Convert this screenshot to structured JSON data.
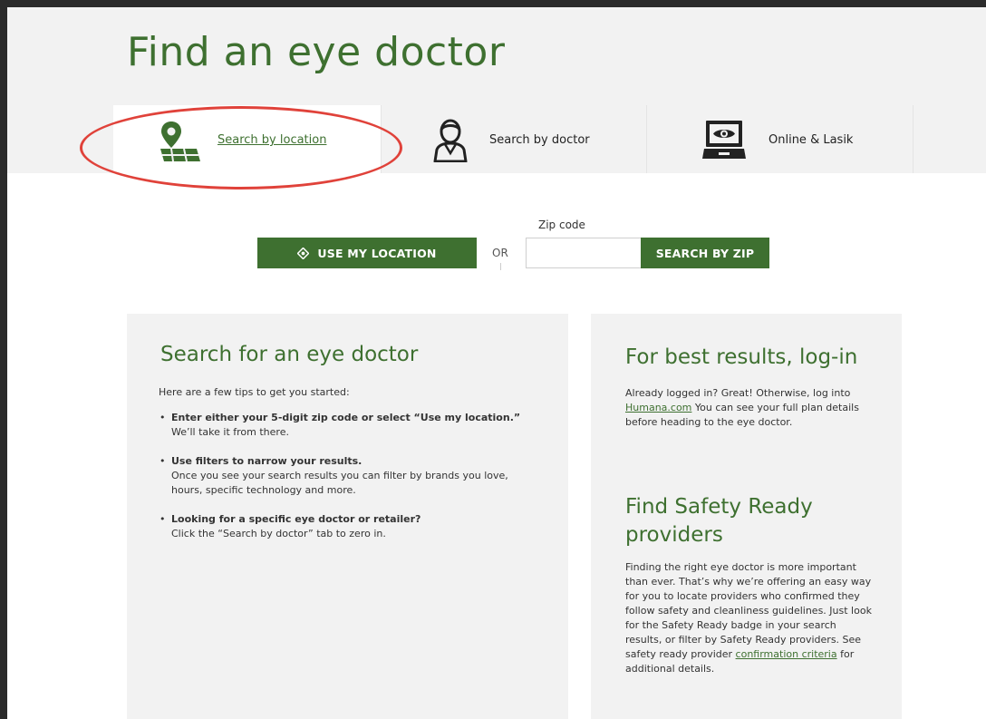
{
  "page": {
    "title": "Find an eye doctor"
  },
  "tabs": [
    {
      "label": "Search by location",
      "icon": "map-pin-icon",
      "active": true
    },
    {
      "label": "Search by doctor",
      "icon": "doctor-icon",
      "active": false
    },
    {
      "label": "Online & Lasik",
      "icon": "laptop-eye-icon",
      "active": false
    }
  ],
  "search": {
    "use_location_label": "USE MY LOCATION",
    "or_label": "OR",
    "zip_label": "Zip code",
    "zip_value": "",
    "zip_placeholder": "",
    "search_zip_label": "SEARCH BY ZIP"
  },
  "left_panel": {
    "heading": "Search for an eye doctor",
    "intro": "Here are a few tips to get you started:",
    "tips": [
      {
        "title": "Enter either your 5-digit zip code or select “Use my location.”",
        "body": "We’ll take it from there."
      },
      {
        "title": "Use filters to narrow your results.",
        "body": "Once you see your search results you can filter by brands you love, hours, specific technology and more."
      },
      {
        "title": "Looking for a specific eye doctor or retailer?",
        "body": "Click the “Search by doctor” tab to zero in."
      }
    ]
  },
  "right_panel": {
    "login_heading": "For best results, log-in",
    "login_text_before": "Already logged in? Great! Otherwise, log into ",
    "login_link": "Humana.com",
    "login_text_after": " You can see your full plan details before heading to the eye doctor.",
    "safety_heading": "Find Safety Ready providers",
    "safety_text_before": "Finding the right eye doctor is more important than ever. That’s why we’re offering an easy way for you to locate providers who confirmed they follow safety and cleanliness guidelines. Just look for the Safety Ready badge in your search results, or filter by Safety Ready providers. See safety ready provider ",
    "safety_link": "confirmation criteria",
    "safety_text_after": " for additional details."
  },
  "colors": {
    "brand_green": "#3e7030",
    "highlight_red": "#e0423a",
    "panel_gray": "#f2f2f2"
  }
}
